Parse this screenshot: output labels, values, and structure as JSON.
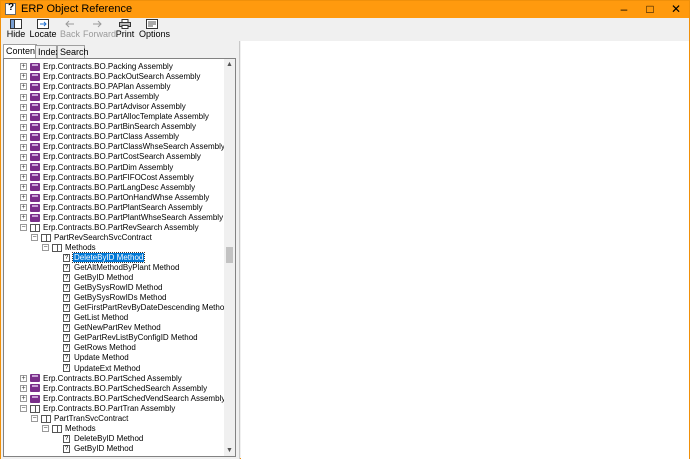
{
  "window": {
    "title": "ERP Object Reference"
  },
  "toolbar": {
    "buttons": [
      {
        "label": "Hide",
        "icon": "hide-icon",
        "enabled": true
      },
      {
        "label": "Locate",
        "icon": "locate-icon",
        "enabled": true
      },
      {
        "label": "Back",
        "icon": "back-arrow-icon",
        "enabled": false
      },
      {
        "label": "Forward",
        "icon": "forward-arrow-icon",
        "enabled": false
      },
      {
        "label": "Print",
        "icon": "printer-icon",
        "enabled": true
      },
      {
        "label": "Options",
        "icon": "options-icon",
        "enabled": true
      }
    ]
  },
  "tabs": [
    "Contents",
    "Index",
    "Search"
  ],
  "tree": [
    {
      "label": "Erp.Contracts.BO.Packing Assembly",
      "level": 0,
      "icon": "book",
      "expander": "+"
    },
    {
      "label": "Erp.Contracts.BO.PackOutSearch Assembly",
      "level": 0,
      "icon": "book",
      "expander": "+"
    },
    {
      "label": "Erp.Contracts.BO.PAPlan Assembly",
      "level": 0,
      "icon": "book",
      "expander": "+"
    },
    {
      "label": "Erp.Contracts.BO.Part Assembly",
      "level": 0,
      "icon": "book",
      "expander": "+"
    },
    {
      "label": "Erp.Contracts.BO.PartAdvisor Assembly",
      "level": 0,
      "icon": "book",
      "expander": "+"
    },
    {
      "label": "Erp.Contracts.BO.PartAllocTemplate Assembly",
      "level": 0,
      "icon": "book",
      "expander": "+"
    },
    {
      "label": "Erp.Contracts.BO.PartBinSearch Assembly",
      "level": 0,
      "icon": "book",
      "expander": "+"
    },
    {
      "label": "Erp.Contracts.BO.PartClass Assembly",
      "level": 0,
      "icon": "book",
      "expander": "+"
    },
    {
      "label": "Erp.Contracts.BO.PartClassWhseSearch Assembly",
      "level": 0,
      "icon": "book",
      "expander": "+"
    },
    {
      "label": "Erp.Contracts.BO.PartCostSearch Assembly",
      "level": 0,
      "icon": "book",
      "expander": "+"
    },
    {
      "label": "Erp.Contracts.BO.PartDim Assembly",
      "level": 0,
      "icon": "book",
      "expander": "+"
    },
    {
      "label": "Erp.Contracts.BO.PartFIFOCost Assembly",
      "level": 0,
      "icon": "book",
      "expander": "+"
    },
    {
      "label": "Erp.Contracts.BO.PartLangDesc Assembly",
      "level": 0,
      "icon": "book",
      "expander": "+"
    },
    {
      "label": "Erp.Contracts.BO.PartOnHandWhse Assembly",
      "level": 0,
      "icon": "book",
      "expander": "+"
    },
    {
      "label": "Erp.Contracts.BO.PartPlantSearch Assembly",
      "level": 0,
      "icon": "book",
      "expander": "+"
    },
    {
      "label": "Erp.Contracts.BO.PartPlantWhseSearch Assembly",
      "level": 0,
      "icon": "book",
      "expander": "+"
    },
    {
      "label": "Erp.Contracts.BO.PartRevSearch Assembly",
      "level": 0,
      "icon": "book-open",
      "expander": "−"
    },
    {
      "label": "PartRevSearchSvcContract",
      "level": 1,
      "icon": "book-open",
      "expander": "−"
    },
    {
      "label": "Methods",
      "level": 2,
      "icon": "book-open",
      "expander": "−"
    },
    {
      "label": "DeleteByID Method",
      "level": 3,
      "icon": "page",
      "selected": true
    },
    {
      "label": "GetAltMethodByPlant Method",
      "level": 3,
      "icon": "page"
    },
    {
      "label": "GetByID Method",
      "level": 3,
      "icon": "page"
    },
    {
      "label": "GetBySysRowID Method",
      "level": 3,
      "icon": "page"
    },
    {
      "label": "GetBySysRowIDs Method",
      "level": 3,
      "icon": "page"
    },
    {
      "label": "GetFirstPartRevByDateDescending Method",
      "level": 3,
      "icon": "page"
    },
    {
      "label": "GetList Method",
      "level": 3,
      "icon": "page"
    },
    {
      "label": "GetNewPartRev Method",
      "level": 3,
      "icon": "page"
    },
    {
      "label": "GetPartRevListByConfigID Method",
      "level": 3,
      "icon": "page"
    },
    {
      "label": "GetRows Method",
      "level": 3,
      "icon": "page"
    },
    {
      "label": "Update Method",
      "level": 3,
      "icon": "page"
    },
    {
      "label": "UpdateExt Method",
      "level": 3,
      "icon": "page"
    },
    {
      "label": "Erp.Contracts.BO.PartSched Assembly",
      "level": 0,
      "icon": "book",
      "expander": "+"
    },
    {
      "label": "Erp.Contracts.BO.PartSchedSearch Assembly",
      "level": 0,
      "icon": "book",
      "expander": "+"
    },
    {
      "label": "Erp.Contracts.BO.PartSchedVendSearch Assembly",
      "level": 0,
      "icon": "book",
      "expander": "+"
    },
    {
      "label": "Erp.Contracts.BO.PartTran Assembly",
      "level": 0,
      "icon": "book-open",
      "expander": "−"
    },
    {
      "label": "PartTranSvcContract",
      "level": 1,
      "icon": "book-open",
      "expander": "−"
    },
    {
      "label": "Methods",
      "level": 2,
      "icon": "book-open",
      "expander": "−"
    },
    {
      "label": "DeleteByID Method",
      "level": 3,
      "icon": "page"
    },
    {
      "label": "GetByID Method",
      "level": 3,
      "icon": "page"
    }
  ],
  "colors": {
    "titlebar": "#ff9a0e",
    "selection": "#0078d7",
    "book": "#7a2f8a"
  }
}
